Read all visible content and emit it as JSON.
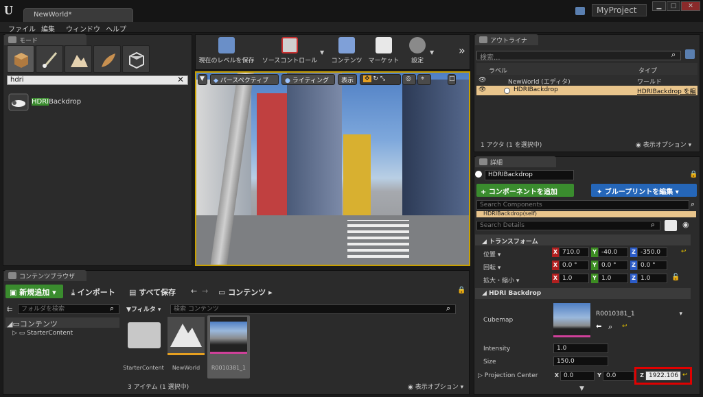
{
  "window": {
    "doc_tab": "NewWorld*",
    "project": "MyProject",
    "min": "▁",
    "max": "□",
    "close": "✕"
  },
  "menu": [
    "ファイル",
    "編集",
    "ウィンドウ",
    "ヘルプ"
  ],
  "modes": {
    "tab": "モード",
    "search_value": "hdri",
    "result_highlight": "HDRI",
    "result_rest": "Backdrop"
  },
  "toolbar": {
    "save": "現在のレベルを保存",
    "source": "ソースコントロール",
    "content": "コンテンツ",
    "market": "マーケット",
    "settings": "設定",
    "more": "»"
  },
  "viewport": {
    "perspective": "パースペクティブ",
    "lighting": "ライティング",
    "show": "表示"
  },
  "outliner": {
    "tab": "アウトライナ",
    "search_placeholder": "検索...",
    "col_label": "ラベル",
    "col_type": "タイプ",
    "rows": [
      {
        "label": "NewWorld (エディタ)",
        "type": "ワールド"
      },
      {
        "label": "HDRIBackdrop",
        "type": "HDRIBackdrop を編"
      }
    ],
    "status": "1 アクタ (1 を選択中)",
    "view_options": "表示オプション"
  },
  "details": {
    "tab": "詳細",
    "name": "HDRIBackdrop",
    "add_component": "+ コンポーネントを追加",
    "edit_blueprint": "ブループリントを編集",
    "search_components": "Search Components",
    "self_item": "HDRIBackdrop(self)",
    "search_details": "Search Details",
    "transform_section": "トランスフォーム",
    "location": {
      "label": "位置",
      "x": "710.0",
      "y": "-40.0",
      "z": "-350.0"
    },
    "rotation": {
      "label": "回転",
      "x": "0.0 °",
      "y": "0.0 °",
      "z": "0.0 °"
    },
    "scale": {
      "label": "拡大・縮小",
      "x": "1.0",
      "y": "1.0",
      "z": "1.0"
    },
    "hdri_section": "HDRI Backdrop",
    "cubemap_label": "Cubemap",
    "cubemap_value": "R0010381_1",
    "intensity_label": "Intensity",
    "intensity_value": "1.0",
    "size_label": "Size",
    "size_value": "150.0",
    "proj_label": "Projection Center",
    "proj_x": "0.0",
    "proj_y": "0.0",
    "proj_z": "1922.106"
  },
  "content_browser": {
    "tab": "コンテンツブラウザ",
    "add_new": "新規追加",
    "import": "インポート",
    "save_all": "すべて保存",
    "path": "コンテンツ",
    "folder_search_placeholder": "フォルダを検索",
    "root_folder": "コンテンツ",
    "sub_folder": "StarterContent",
    "filter": "フィルタ",
    "search_placeholder": "検索 コンテンツ",
    "assets": [
      "StarterContent",
      "NewWorld",
      "R0010381_1"
    ],
    "status": "3 アイテム (1 選択中)",
    "view_options": "表示オプション"
  },
  "colors": {
    "accent_orange": "#c8a000",
    "green": "#3a8c2e",
    "blue": "#2566b8",
    "highlight_red": "#e00000",
    "x_axis": "#b02020",
    "y_axis": "#3c8c22",
    "z_axis": "#2c5cc8"
  }
}
